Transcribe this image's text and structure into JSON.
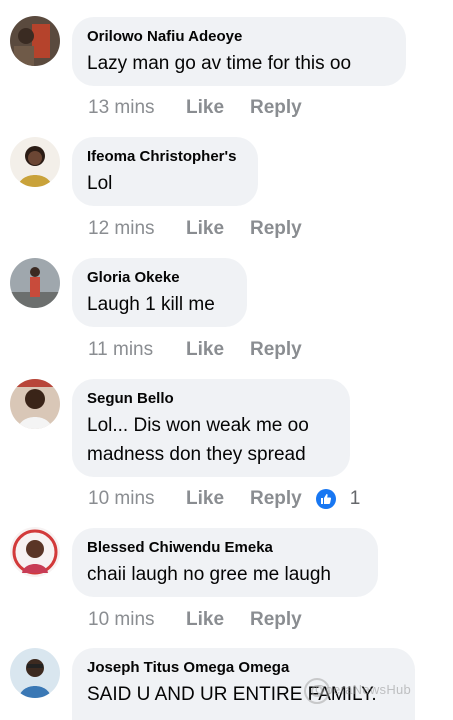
{
  "comments": [
    {
      "author": "Orilowo Nafiu Adeoye",
      "text": "Lazy man go av time for  this oo",
      "time": "13 mins",
      "like": "Like",
      "reply": "Reply",
      "avatar_icon": "user-avatar-icon"
    },
    {
      "author": "Ifeoma Christopher's",
      "text": "Lol",
      "time": "12 mins",
      "like": "Like",
      "reply": "Reply",
      "avatar_icon": "user-avatar-icon"
    },
    {
      "author": "Gloria Okeke",
      "text": "Laugh 1 kill me",
      "time": "11 mins",
      "like": "Like",
      "reply": "Reply",
      "avatar_icon": "user-avatar-icon"
    },
    {
      "author": "Segun Bello",
      "text": "Lol... Dis won weak me oo\nmadness don they spread",
      "time": "10 mins",
      "like": "Like",
      "reply": "Reply",
      "reaction_icon": "thumbs-up-icon",
      "reaction_count": "1",
      "avatar_icon": "user-avatar-icon"
    },
    {
      "author": "Blessed Chiwendu Emeka",
      "text": "chaii laugh no gree me laugh",
      "time": "10 mins",
      "like": "Like",
      "reply": "Reply",
      "avatar_icon": "user-avatar-icon"
    },
    {
      "author": "Joseph Titus Omega Omega",
      "text": "SAID U AND UR ENTIRE FAMILY.",
      "avatar_icon": "user-avatar-icon"
    }
  ],
  "watermark": "OperaNewsHub",
  "colors": {
    "bubble": "#f0f2f5",
    "meta_text": "#8a8d91",
    "like_reaction": "#1877f2"
  }
}
